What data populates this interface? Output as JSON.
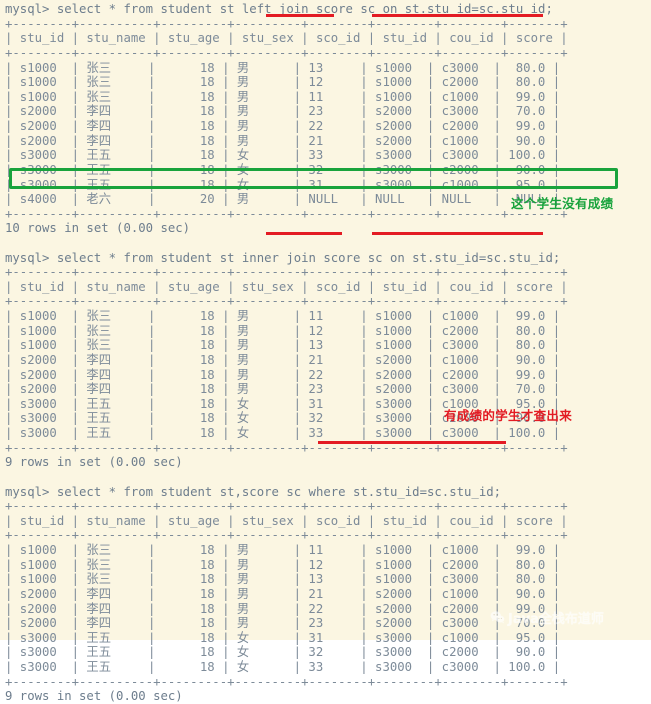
{
  "terminal": {
    "background_color": "#fbf6e2",
    "text_color": "#7d8b99",
    "accent_red": "#e31b23",
    "accent_green": "#19a33c"
  },
  "columns": [
    "stu_id",
    "stu_name",
    "stu_age",
    "stu_sex",
    "sco_id",
    "stu_id",
    "cou_id",
    "score"
  ],
  "separator": "+--------+----------+---------+---------+--------+--------+--------+-------+",
  "header_row": "| stu_id | stu_name | stu_age | stu_sex | sco_id | stu_id | cou_id | score |",
  "blocks": [
    {
      "id": "left-join",
      "prompt": "mysql> select * from student st left join score sc on st.stu_id=sc.stu_id;",
      "rows": [
        "| s1000  | 张三     |      18 | 男      | 13     | s1000  | c3000  |  80.0 |",
        "| s1000  | 张三     |      18 | 男      | 12     | s1000  | c2000  |  80.0 |",
        "| s1000  | 张三     |      18 | 男      | 11     | s1000  | c1000  |  99.0 |",
        "| s2000  | 李四     |      18 | 男      | 23     | s2000  | c3000  |  70.0 |",
        "| s2000  | 李四     |      18 | 男      | 22     | s2000  | c2000  |  99.0 |",
        "| s2000  | 李四     |      18 | 男      | 21     | s2000  | c1000  |  90.0 |",
        "| s3000  | 王五     |      18 | 女      | 33     | s3000  | c3000  | 100.0 |",
        "| s3000  | 王五     |      18 | 女      | 32     | s3000  | c2000  |  90.0 |",
        "| s3000  | 王五     |      18 | 女      | 31     | s3000  | c1000  |  95.0 |",
        "| s4000  | 老六     |      20 | 男      | NULL   | NULL   | NULL   |  NULL |"
      ],
      "status": "10 rows in set (0.00 sec)",
      "annotation": "这个学生没有成绩",
      "annotation_color": "green"
    },
    {
      "id": "inner-join",
      "prompt": "mysql> select * from student st inner join score sc on st.stu_id=sc.stu_id;",
      "rows": [
        "| s1000  | 张三     |      18 | 男      | 11     | s1000  | c1000  |  99.0 |",
        "| s1000  | 张三     |      18 | 男      | 12     | s1000  | c2000  |  80.0 |",
        "| s1000  | 张三     |      18 | 男      | 13     | s1000  | c3000  |  80.0 |",
        "| s2000  | 李四     |      18 | 男      | 21     | s2000  | c1000  |  90.0 |",
        "| s2000  | 李四     |      18 | 男      | 22     | s2000  | c2000  |  99.0 |",
        "| s2000  | 李四     |      18 | 男      | 23     | s2000  | c3000  |  70.0 |",
        "| s3000  | 王五     |      18 | 女      | 31     | s3000  | c1000  |  95.0 |",
        "| s3000  | 王五     |      18 | 女      | 32     | s3000  | c2000  |  90.0 |",
        "| s3000  | 王五     |      18 | 女      | 33     | s3000  | c3000  | 100.0 |"
      ],
      "status": "9 rows in set (0.00 sec)",
      "annotation": "有成绩的学生才查出来",
      "annotation_color": "red"
    },
    {
      "id": "where-join",
      "prompt": "mysql> select * from student st,score sc where st.stu_id=sc.stu_id;",
      "rows": [
        "| s1000  | 张三     |      18 | 男      | 11     | s1000  | c1000  |  99.0 |",
        "| s1000  | 张三     |      18 | 男      | 12     | s1000  | c2000  |  80.0 |",
        "| s1000  | 张三     |      18 | 男      | 13     | s1000  | c3000  |  80.0 |",
        "| s2000  | 李四     |      18 | 男      | 21     | s2000  | c1000  |  90.0 |",
        "| s2000  | 李四     |      18 | 男      | 22     | s2000  | c2000  |  99.0 |",
        "| s2000  | 李四     |      18 | 男      | 23     | s2000  | c3000  |  70.0 |",
        "| s3000  | 王五     |      18 | 女      | 31     | s3000  | c1000  |  95.0 |",
        "| s3000  | 王五     |      18 | 女      | 32     | s3000  | c2000  |  90.0 |",
        "| s3000  | 王五     |      18 | 女      | 33     | s3000  | c3000  | 100.0 |"
      ],
      "status": "9 rows in set (0.00 sec)",
      "annotation": null,
      "annotation_color": null
    }
  ],
  "watermark": {
    "label": "Java全栈布道师",
    "icon": "wechat-icon"
  }
}
